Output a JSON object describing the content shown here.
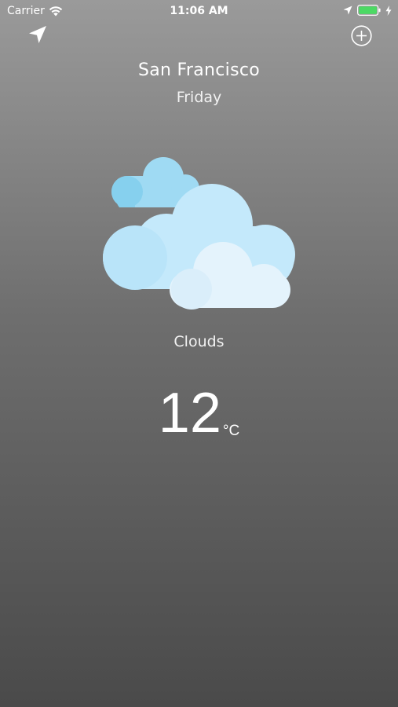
{
  "status_bar": {
    "carrier": "Carrier",
    "time": "11:06 AM",
    "icons": [
      "wifi-icon",
      "location-arrow-icon",
      "battery-icon",
      "charging-bolt-icon"
    ],
    "battery_color": "#4cd964"
  },
  "toolbar": {
    "locate_icon": "location-arrow-icon",
    "add_icon": "plus-circle-icon"
  },
  "location": {
    "city": "San Francisco",
    "day": "Friday"
  },
  "weather": {
    "icon": "clouds-icon",
    "condition": "Clouds",
    "temperature": "12",
    "unit": "°C"
  },
  "colors": {
    "cloud_light": "#e3f2fc",
    "cloud_mid": "#bfe6fb",
    "cloud_dark": "#94d6f1"
  }
}
